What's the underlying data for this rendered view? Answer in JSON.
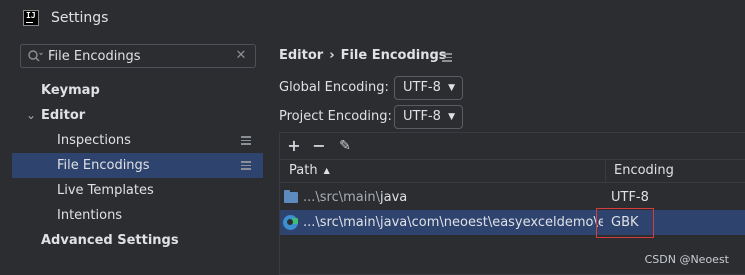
{
  "window": {
    "title": "Settings",
    "logo_text": "IJ"
  },
  "search": {
    "value": "File Encodings",
    "placeholder": ""
  },
  "sidebar": {
    "items": [
      {
        "label": "Keymap"
      },
      {
        "label": "Editor"
      },
      {
        "label": "Inspections"
      },
      {
        "label": "File Encodings"
      },
      {
        "label": "Live Templates"
      },
      {
        "label": "Intentions"
      },
      {
        "label": "Advanced Settings"
      }
    ]
  },
  "breadcrumb": {
    "parent": "Editor",
    "separator": "›",
    "current": "File Encodings"
  },
  "global_encoding": {
    "label": "Global Encoding:",
    "value": "UTF-8"
  },
  "project_encoding": {
    "label": "Project Encoding:",
    "value": "UTF-8"
  },
  "toolbar": {
    "add": "+",
    "remove": "−",
    "edit": "✎"
  },
  "table": {
    "columns": [
      "Path",
      "Encoding"
    ],
    "rows": [
      {
        "path_prefix": "...\\src\\main\\",
        "path_name": "java",
        "encoding": "UTF-8"
      },
      {
        "path_prefix": "",
        "path_name": "...\\src\\main\\java\\com\\neoest\\easyexceldemo\\entity\\",
        "encoding": "GBK"
      }
    ]
  },
  "watermark": "CSDN @Neoest",
  "colors": {
    "selection": "#2e436e",
    "highlight_box": "#d53d3d",
    "background": "#2b2d30"
  }
}
